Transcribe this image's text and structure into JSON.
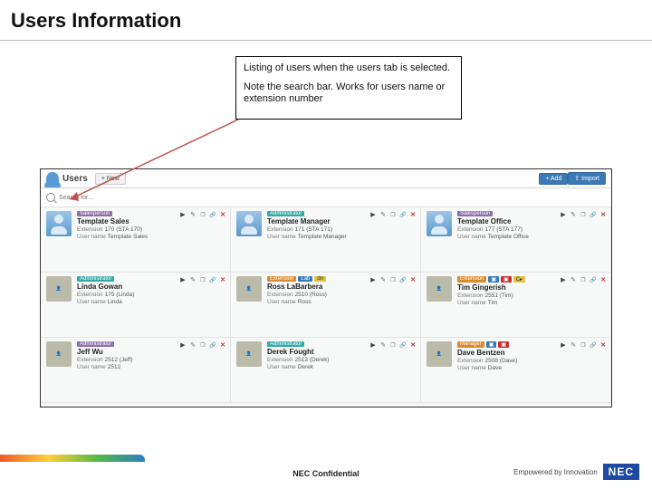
{
  "slide": {
    "title": "Users Information",
    "callout_line1": "Listing of users when the users tab is selected.",
    "callout_line2": "Note the search bar. Works for users name or extension number"
  },
  "topbar": {
    "title": "Users",
    "new_button": "+ New",
    "add_button": "+ Add",
    "import_button": "⇪ Import"
  },
  "search": {
    "placeholder": "Search for..."
  },
  "labels": {
    "extension": "Extension",
    "username": "User name"
  },
  "users": [
    {
      "name": "Template Sales",
      "extension": "170 (STA 170)",
      "username": "Template Sales",
      "avatar": "generic",
      "badges": [
        {
          "text": "Salesperson",
          "cls": "bg-purple"
        }
      ]
    },
    {
      "name": "Template Manager",
      "extension": "171 (STA 171)",
      "username": "Template Manager",
      "avatar": "generic",
      "badges": [
        {
          "text": "Administrator",
          "cls": "bg-teal"
        }
      ]
    },
    {
      "name": "Template Office",
      "extension": "177 (STA 177)",
      "username": "Template Office",
      "avatar": "generic",
      "badges": [
        {
          "text": "Salesperson",
          "cls": "bg-purple"
        }
      ]
    },
    {
      "name": "Linda Gowan",
      "extension": "175 (Linda)",
      "username": "Linda",
      "avatar": "photo",
      "badges": [
        {
          "text": "Administrator",
          "cls": "bg-teal"
        }
      ]
    },
    {
      "name": "Ross LaBarbera",
      "extension": "2510 (Ross)",
      "username": "Ross",
      "avatar": "photo",
      "badges": [
        {
          "text": "Extension",
          "cls": "bg-orange"
        },
        {
          "text": "Lab",
          "cls": "bg-blue"
        },
        {
          "text": "dn",
          "cls": "bg-yellow"
        }
      ]
    },
    {
      "name": "Tim Gingerish",
      "extension": "2551 (Tim)",
      "username": "Tim",
      "avatar": "photo",
      "badges": [
        {
          "text": "Extension",
          "cls": "bg-orange"
        },
        {
          "text": "▣",
          "cls": "bg-blue"
        },
        {
          "text": "▣",
          "cls": "bg-red"
        },
        {
          "text": "C▸",
          "cls": "bg-yellow"
        }
      ]
    },
    {
      "name": "Jeff Wu",
      "extension": "2512 (Jeff)",
      "username": "2512",
      "avatar": "photo",
      "badges": [
        {
          "text": "Administrator",
          "cls": "bg-purple"
        }
      ]
    },
    {
      "name": "Derek Fought",
      "extension": "2513 (Derek)",
      "username": "Derek",
      "avatar": "photo",
      "badges": [
        {
          "text": "Administrator",
          "cls": "bg-teal"
        }
      ]
    },
    {
      "name": "Dave Bentzen",
      "extension": "2508 (Dave)",
      "username": "Dave",
      "avatar": "photo",
      "badges": [
        {
          "text": "Manager",
          "cls": "bg-orange"
        },
        {
          "text": "▣",
          "cls": "bg-blue"
        },
        {
          "text": "▣",
          "cls": "bg-red"
        }
      ]
    }
  ],
  "footer": {
    "confidential": "NEC Confidential",
    "tagline": "Empowered by Innovation",
    "brand": "NEC"
  }
}
